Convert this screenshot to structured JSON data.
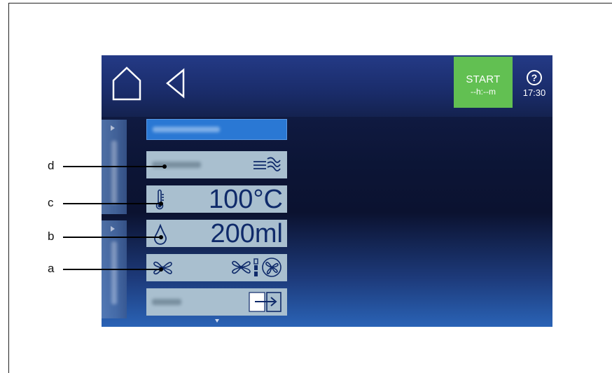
{
  "header": {
    "start_label": "START",
    "start_time": "--h:--m",
    "clock": "17:30"
  },
  "rows": {
    "temperature_value": "100°C",
    "volume_value": "200ml"
  },
  "callouts": [
    "d",
    "c",
    "b",
    "a"
  ],
  "colors": {
    "start_green": "#62c052",
    "row_bg": "#a9bfcf",
    "title_blue": "#2a78d4",
    "value_text": "#0f2a6a"
  },
  "icons": {
    "home": "home-icon",
    "back": "back-arrow-icon",
    "help": "help-icon",
    "steam": "steam-icon",
    "thermometer": "thermometer-icon",
    "drop": "water-drop-icon",
    "fan": "fan-icon",
    "fan_speed": "fan-speed-icon",
    "fan_direction": "fan-direction-icon",
    "exit": "exit-door-icon"
  }
}
